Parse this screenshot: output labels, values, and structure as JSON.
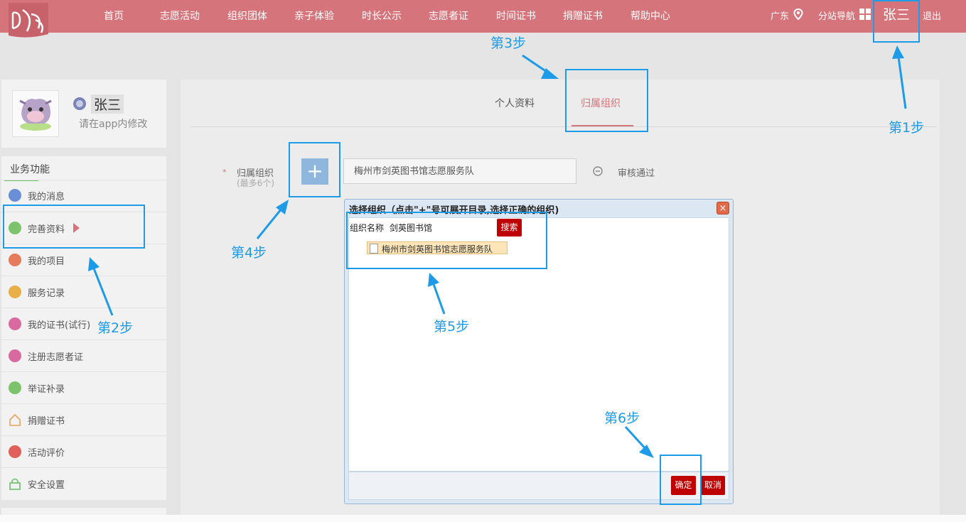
{
  "nav": {
    "items": [
      "首页",
      "志愿活动",
      "组织团体",
      "亲子体验",
      "时长公示",
      "志愿者证",
      "时间证书",
      "捐赠证书",
      "帮助中心"
    ],
    "region": "广东",
    "subsite": "分站导航",
    "username": "张三",
    "logout": "退出"
  },
  "profile": {
    "name": "张三",
    "hint": "请在app内修改"
  },
  "sidebar": {
    "title": "业务功能",
    "items": [
      {
        "label": "我的消息",
        "icon": "message-icon",
        "color": "#6b8fd6"
      },
      {
        "label": "完善资料",
        "icon": "edit-icon",
        "color": "#7cc36b"
      },
      {
        "label": "我的项目",
        "icon": "project-icon",
        "color": "#e57d5d"
      },
      {
        "label": "服务记录",
        "icon": "list-icon",
        "color": "#e9b04a"
      },
      {
        "label": "我的证书(试行)",
        "icon": "certificate-icon",
        "color": "#d96aa0"
      },
      {
        "label": "注册志愿者证",
        "icon": "hourglass-icon",
        "color": "#d96aa0"
      },
      {
        "label": "举证补录",
        "icon": "edit-icon",
        "color": "#7cc36b"
      },
      {
        "label": "捐赠证书",
        "icon": "home-icon",
        "color": "#e9a45a"
      },
      {
        "label": "活动评价",
        "icon": "star-icon",
        "color": "#e0615a"
      },
      {
        "label": "安全设置",
        "icon": "lock-icon",
        "color": "#6cbf6c"
      }
    ]
  },
  "tabs": {
    "profile": "个人资料",
    "org": "归属组织"
  },
  "form": {
    "required_mark": "*",
    "label": "归属组织",
    "sublabel": "(最多6个)",
    "plus": "+",
    "org_value": "梅州市剑英图书馆志愿服务队",
    "status": "审核通过"
  },
  "dialog": {
    "title": "选择组织（点击\"+\"号可展开目录,选择正确的组织)",
    "close": "×",
    "name_label": "组织名称",
    "name_value": "剑英图书馆",
    "search": "搜索",
    "result": "梅州市剑英图书馆志愿服务队",
    "ok": "确定",
    "cancel": "取消"
  },
  "steps": {
    "s1": "第1步",
    "s2": "第2步",
    "s3": "第3步",
    "s4": "第4步",
    "s5": "第5步",
    "s6": "第6步"
  },
  "colors": {
    "nav": "#d5747a",
    "annotation": "#1e9be8",
    "danger": "#c00000"
  }
}
